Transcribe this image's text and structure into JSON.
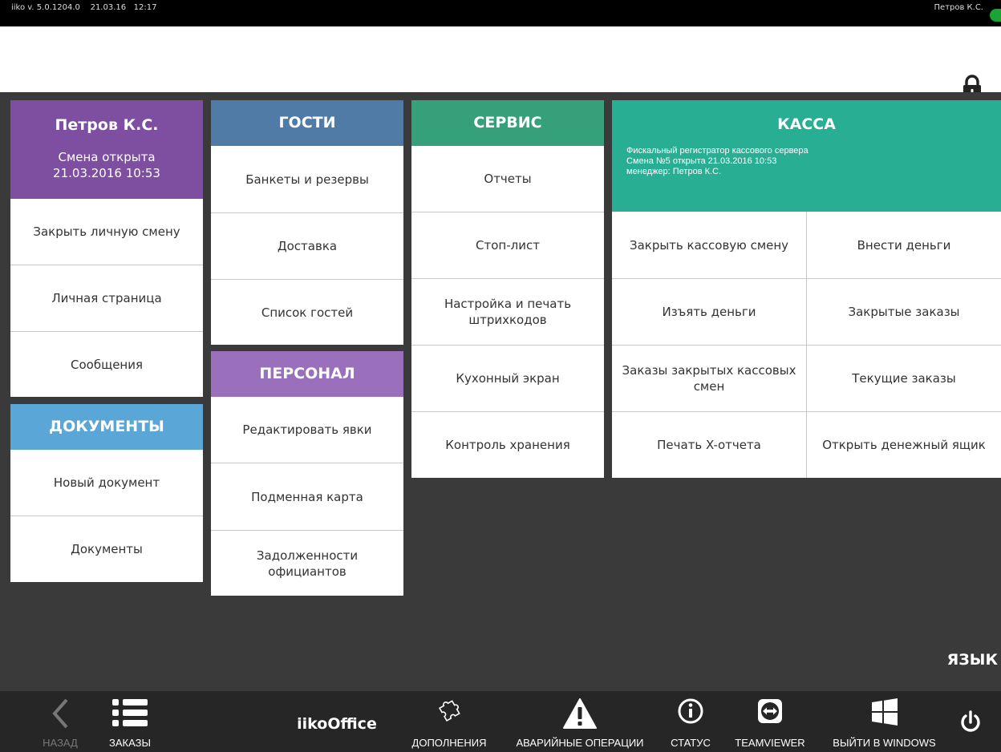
{
  "topbar": {
    "version": "iiko v. 5.0.1204.0",
    "date": "21.03.16",
    "time": "12:17",
    "user": "Петров К.С.",
    "status_color": "#1ca338"
  },
  "header": {
    "lock_icon": "lock-icon"
  },
  "user_panel": {
    "name": "Петров К.С.",
    "shift_status": "Смена открыта",
    "shift_datetime": "21.03.2016 10:53",
    "color": "#7e4fa1",
    "items": [
      "Закрыть личную смену",
      "Личная страница",
      "Сообщения"
    ]
  },
  "documents": {
    "title": "ДОКУМЕНТЫ",
    "color": "#5aa6d6",
    "items": [
      "Новый документ",
      "Документы"
    ]
  },
  "guests": {
    "title": "ГОСТИ",
    "color": "#4f7ba6",
    "items": [
      "Банкеты и резервы",
      "Доставка",
      "Список гостей"
    ]
  },
  "staff": {
    "title": "ПЕРСОНАЛ",
    "color": "#9a6fbb",
    "items": [
      "Редактировать явки",
      "Подменная карта",
      "Задолженности официантов"
    ]
  },
  "service": {
    "title": "СЕРВИС",
    "color": "#35a07a",
    "items": [
      "Отчеты",
      "Стоп-лист",
      "Настройка и печать штрихкодов",
      "Кухонный экран",
      "Контроль хранения"
    ]
  },
  "kassa": {
    "title": "КАССА",
    "color": "#27ae93",
    "info_line1": "Фискальный регистратор кассового сервера",
    "info_line2": "Смена №5 открыта 21.03.2016 10:53",
    "info_line3": "менеджер: Петров К.С.",
    "items": [
      "Закрыть кассовую смену",
      "Внести деньги",
      "Изъять деньги",
      "Закрытые заказы",
      "Заказы закрытых кассовых смен",
      "Текущие заказы",
      "Печать X-отчета",
      "Открыть денежный ящик"
    ]
  },
  "language_label": "ЯЗЫК",
  "bottom": {
    "back": "НАЗАД",
    "orders": "ЗАКАЗЫ",
    "app_name": "iikoOffice",
    "addons": "ДОПОЛНЕНИЯ",
    "emergency": "АВАРИЙНЫЕ ОПЕРАЦИИ",
    "status": "СТАТУС",
    "teamviewer": "TEAMVIEWER",
    "exit_windows": "ВЫЙТИ В WINDOWS",
    "power_icon": "power-icon"
  }
}
